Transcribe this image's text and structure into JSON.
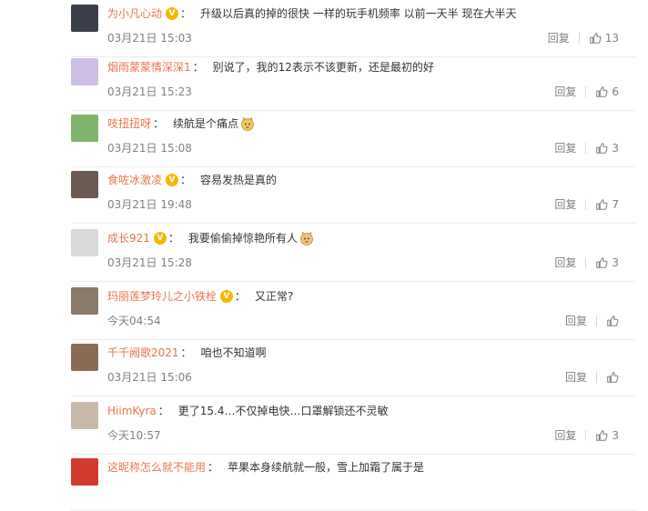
{
  "comments": [
    {
      "user": "为小凡心动",
      "verified": true,
      "text": "升级以后真的掉的很快 一样的玩手机频率 以前一天半 现在大半天",
      "emoji": "",
      "time": "03月21日 15:03",
      "reply": "回复",
      "likes": "13",
      "avatar_color": "#3b3f4a"
    },
    {
      "user": "烟雨蒙蒙情深深1",
      "verified": false,
      "text": "别说了，我的12表示不该更新，还是最初的好",
      "emoji": "",
      "time": "03月21日 15:23",
      "reply": "回复",
      "likes": "6",
      "avatar_color": "#cdbfe6"
    },
    {
      "user": "吱扭扭呀",
      "verified": false,
      "text": "续航是个痛点",
      "emoji": "doge-emoji",
      "time": "03月21日 15:08",
      "reply": "回复",
      "likes": "3",
      "avatar_color": "#7fb56a"
    },
    {
      "user": "食咗冰激凌",
      "verified": true,
      "text": "容易发热是真的",
      "emoji": "",
      "time": "03月21日 19:48",
      "reply": "回复",
      "likes": "7",
      "avatar_color": "#6b5a52"
    },
    {
      "user": "成长921",
      "verified": true,
      "text": "我要偷偷掉惊艳所有人",
      "emoji": "cat-emoji",
      "time": "03月21日 15:28",
      "reply": "回复",
      "likes": "3",
      "avatar_color": "#d9d9d9"
    },
    {
      "user": "玛丽莲梦玲儿之小铁栓",
      "verified": true,
      "text": "又正常?",
      "emoji": "",
      "time": "今天04:54",
      "reply": "回复",
      "likes": "",
      "avatar_color": "#8a7a6a"
    },
    {
      "user": "千千阙歌2021",
      "verified": false,
      "text": "咱也不知道啊",
      "emoji": "",
      "time": "03月21日 15:06",
      "reply": "回复",
      "likes": "",
      "avatar_color": "#8c6b55"
    },
    {
      "user": "HiimKyra",
      "verified": false,
      "text": "更了15.4…不仅掉电快…口罩解锁还不灵敏",
      "emoji": "",
      "time": "今天10:57",
      "reply": "回复",
      "likes": "3",
      "avatar_color": "#c9b9a8"
    },
    {
      "user": "这昵称怎么就不能用",
      "verified": false,
      "text": "苹果本身续航就一般，雪上加霜了属于是",
      "emoji": "",
      "time": "",
      "reply": "",
      "likes": "",
      "avatar_color": "#d23a2f"
    }
  ],
  "verified_mark": "V"
}
